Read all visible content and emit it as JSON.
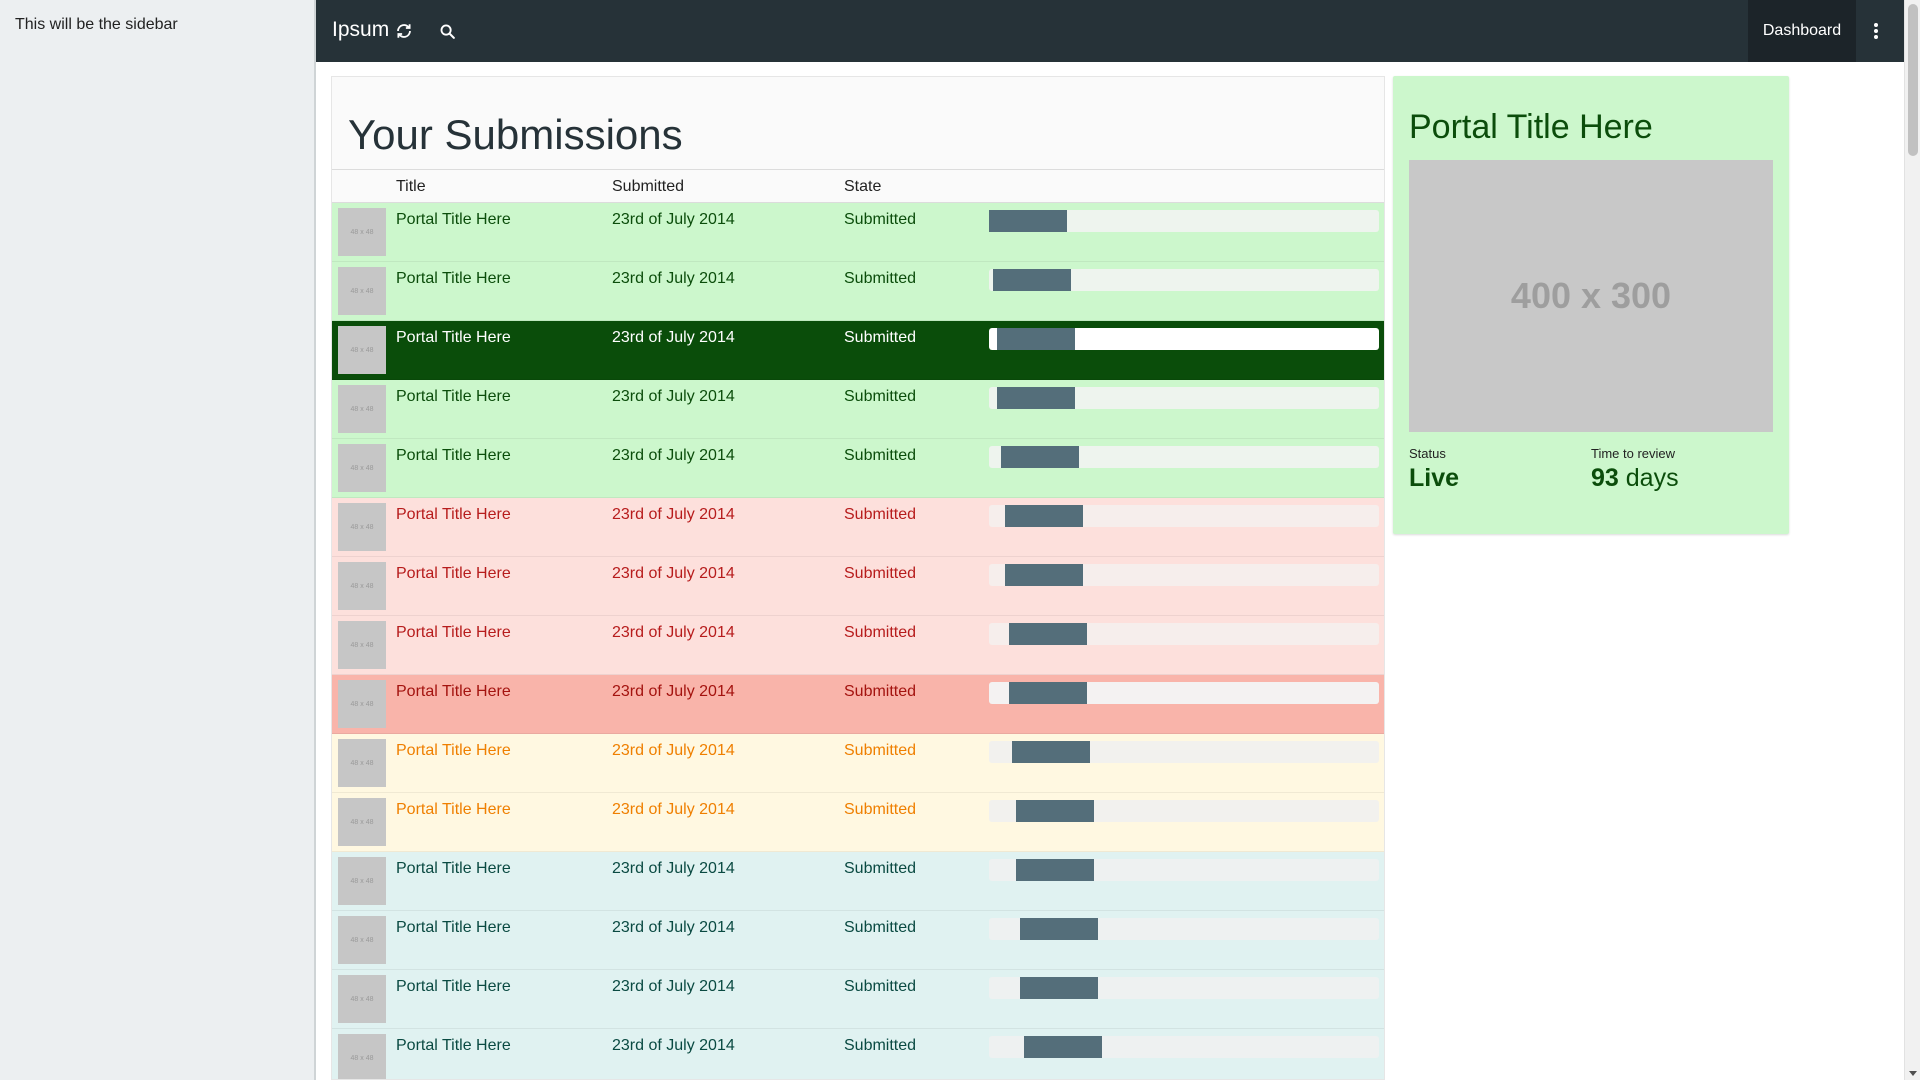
{
  "sidebar": {
    "text": "This will be the sidebar"
  },
  "topbar": {
    "brand": "Ipsum",
    "refresh_icon": "refresh-icon",
    "search_icon": "search-icon",
    "dashboard_label": "Dashboard",
    "more_icon": "more-vert-icon"
  },
  "main": {
    "title": "Your Submissions",
    "columns": {
      "title": "Title",
      "submitted": "Submitted",
      "state": "State"
    },
    "rows": [
      {
        "thumb": "48 x 48",
        "title": "Portal Title Here",
        "date": "23rd of July 2014",
        "state": "Submitted",
        "theme": "green",
        "progress_start": 0.0,
        "progress_end": 0.2
      },
      {
        "thumb": "48 x 48",
        "title": "Portal Title Here",
        "date": "23rd of July 2014",
        "state": "Submitted",
        "theme": "green",
        "progress_start": 0.01,
        "progress_end": 0.21
      },
      {
        "thumb": "48 x 48",
        "title": "Portal Title Here",
        "date": "23rd of July 2014",
        "state": "Submitted",
        "theme": "green-active",
        "progress_start": 0.02,
        "progress_end": 0.22
      },
      {
        "thumb": "48 x 48",
        "title": "Portal Title Here",
        "date": "23rd of July 2014",
        "state": "Submitted",
        "theme": "green",
        "progress_start": 0.02,
        "progress_end": 0.22
      },
      {
        "thumb": "48 x 48",
        "title": "Portal Title Here",
        "date": "23rd of July 2014",
        "state": "Submitted",
        "theme": "green",
        "progress_start": 0.03,
        "progress_end": 0.23
      },
      {
        "thumb": "48 x 48",
        "title": "Portal Title Here",
        "date": "23rd of July 2014",
        "state": "Submitted",
        "theme": "red",
        "progress_start": 0.04,
        "progress_end": 0.24
      },
      {
        "thumb": "48 x 48",
        "title": "Portal Title Here",
        "date": "23rd of July 2014",
        "state": "Submitted",
        "theme": "red",
        "progress_start": 0.04,
        "progress_end": 0.24
      },
      {
        "thumb": "48 x 48",
        "title": "Portal Title Here",
        "date": "23rd of July 2014",
        "state": "Submitted",
        "theme": "red",
        "progress_start": 0.05,
        "progress_end": 0.25
      },
      {
        "thumb": "48 x 48",
        "title": "Portal Title Here",
        "date": "23rd of July 2014",
        "state": "Submitted",
        "theme": "red-active",
        "progress_start": 0.05,
        "progress_end": 0.25
      },
      {
        "thumb": "48 x 48",
        "title": "Portal Title Here",
        "date": "23rd of July 2014",
        "state": "Submitted",
        "theme": "yellow",
        "progress_start": 0.06,
        "progress_end": 0.26
      },
      {
        "thumb": "48 x 48",
        "title": "Portal Title Here",
        "date": "23rd of July 2014",
        "state": "Submitted",
        "theme": "yellow",
        "progress_start": 0.07,
        "progress_end": 0.27
      },
      {
        "thumb": "48 x 48",
        "title": "Portal Title Here",
        "date": "23rd of July 2014",
        "state": "Submitted",
        "theme": "teal",
        "progress_start": 0.07,
        "progress_end": 0.27
      },
      {
        "thumb": "48 x 48",
        "title": "Portal Title Here",
        "date": "23rd of July 2014",
        "state": "Submitted",
        "theme": "teal",
        "progress_start": 0.08,
        "progress_end": 0.28
      },
      {
        "thumb": "48 x 48",
        "title": "Portal Title Here",
        "date": "23rd of July 2014",
        "state": "Submitted",
        "theme": "teal",
        "progress_start": 0.08,
        "progress_end": 0.28
      },
      {
        "thumb": "48 x 48",
        "title": "Portal Title Here",
        "date": "23rd of July 2014",
        "state": "Submitted",
        "theme": "teal",
        "progress_start": 0.09,
        "progress_end": 0.29
      }
    ]
  },
  "detail_card": {
    "title": "Portal Title Here",
    "image_placeholder": "400 x 300",
    "status_label": "Status",
    "status_value": "Live",
    "review_label": "Time to review",
    "review_number": "93",
    "review_unit": "days"
  },
  "colors": {
    "topbar": "#263238",
    "green_row": "#ccf7cc",
    "green_active_row": "#0a4d0a",
    "red_row": "#fde0dc",
    "red_active_row": "#f9b4aa",
    "yellow_row": "#fff8e1",
    "teal_row": "#e0f2f1",
    "progress_fill": "#546e7a"
  }
}
